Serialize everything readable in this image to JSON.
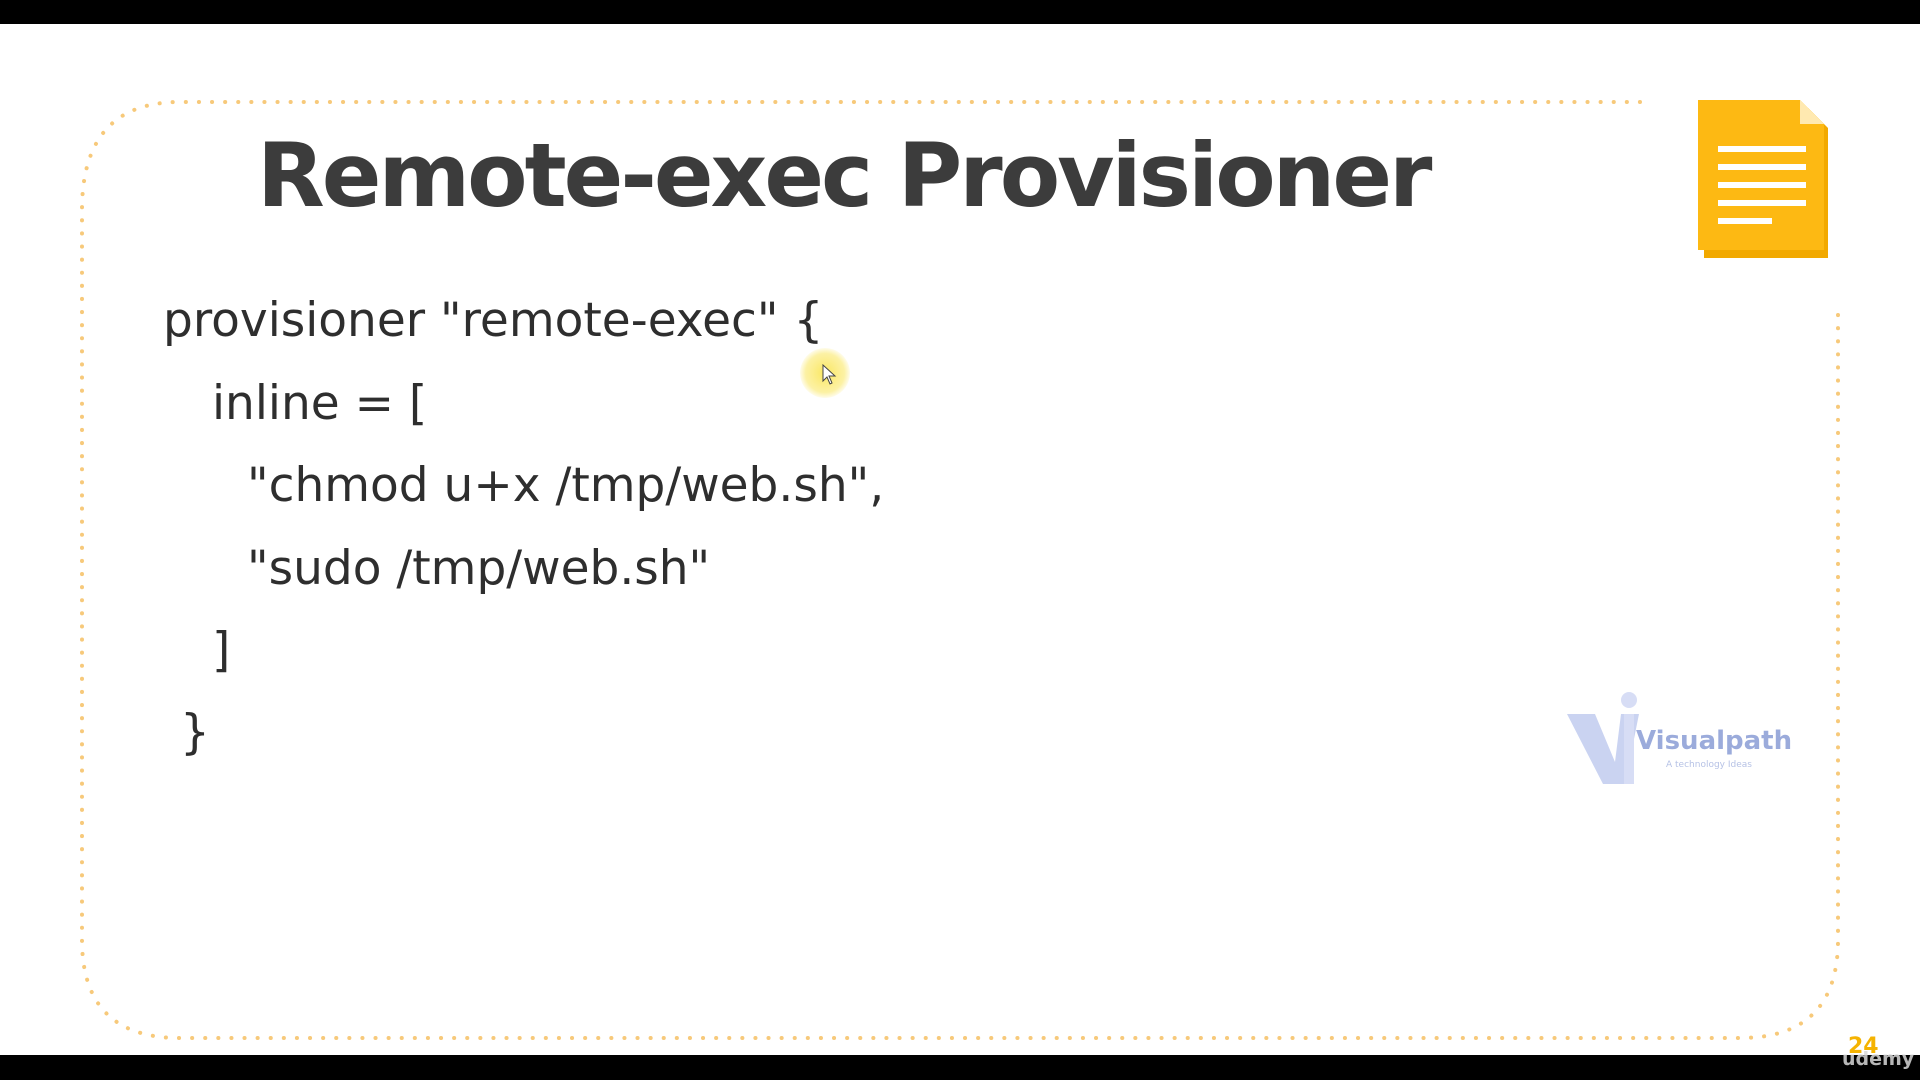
{
  "slide": {
    "title": "Remote-exec Provisioner",
    "code_lines": [
      "provisioner \"remote-exec\" {",
      "inline = [",
      "\"chmod u+x /tmp/web.sh\",",
      "\"sudo /tmp/web.sh\"",
      "]",
      "}"
    ],
    "slide_number": "24",
    "icons": {
      "document": "document-icon",
      "cursor": "mouse-cursor-icon"
    },
    "colors": {
      "accent": "#f5b301",
      "frame_dots": "#f7c97a",
      "title": "#3c3c3c",
      "code": "#2e2e2e"
    }
  },
  "watermark": {
    "brand": "Visualpath",
    "tagline": "A technology Ideas"
  },
  "player": {
    "watermark": "udemy"
  }
}
